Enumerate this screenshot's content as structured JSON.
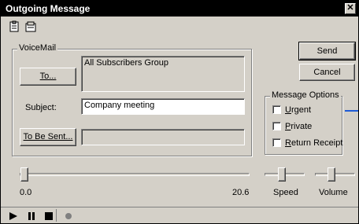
{
  "window": {
    "title": "Outgoing Message"
  },
  "toolbar": {
    "icons": [
      "paste-icon",
      "attach-icon"
    ]
  },
  "voicemail": {
    "group_label": "VoiceMail",
    "to_button_label": "To...",
    "recipients_value": "All Subscribers Group",
    "subject_label": "Subject:",
    "subject_value": "Company meeting",
    "to_be_sent_button_label": "To Be Sent...",
    "to_be_sent_value": ""
  },
  "actions": {
    "send_label": "Send",
    "cancel_label": "Cancel"
  },
  "message_options": {
    "group_label": "Message Options",
    "urgent_label": "Urgent",
    "urgent_checked": false,
    "private_label": "Private",
    "private_checked": false,
    "return_receipt_label": "Return Receipt",
    "return_receipt_checked": false
  },
  "playback": {
    "position_start": "0.0",
    "position_end": "20.6",
    "position_value": 0.0,
    "speed_label": "Speed",
    "volume_label": "Volume"
  },
  "colors": {
    "title_bg": "#000000",
    "face": "#d4d0c8",
    "accent_line": "#1e5bd6"
  }
}
